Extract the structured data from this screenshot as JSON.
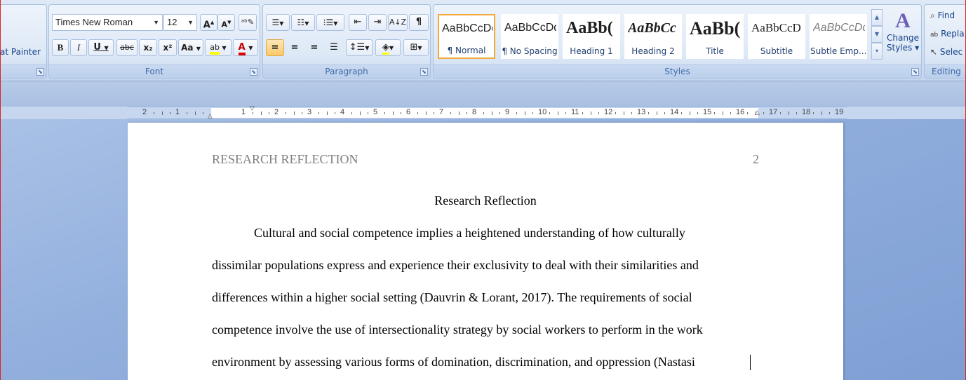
{
  "clipboard": {
    "format_painter_label": "at Painter"
  },
  "font": {
    "group_label": "Font",
    "font_name": "Times New Roman",
    "font_size": "12",
    "grow": "A",
    "shrink": "A",
    "bold": "B",
    "italic": "I",
    "underline": "U",
    "strike": "abc",
    "subscript": "x₂",
    "superscript": "x²",
    "change_case": "Aa",
    "highlight": "ab",
    "font_color": "A"
  },
  "paragraph": {
    "group_label": "Paragraph",
    "pilcrow": "¶"
  },
  "styles": {
    "group_label": "Styles",
    "items": [
      {
        "sample": "AaBbCcDd",
        "name": "¶ Normal"
      },
      {
        "sample": "AaBbCcDd",
        "name": "¶ No Spacing"
      },
      {
        "sample": "AaBb(",
        "name": "Heading 1"
      },
      {
        "sample": "AaBbCc",
        "name": "Heading 2"
      },
      {
        "sample": "AaBb(",
        "name": "Title"
      },
      {
        "sample": "AaBbCcD",
        "name": "Subtitle"
      },
      {
        "sample": "AaBbCcDd",
        "name": "Subtle Emp..."
      }
    ],
    "change_styles_line1": "Change",
    "change_styles_line2": "Styles ▾"
  },
  "editing": {
    "group_label": "Editing",
    "find": "Find",
    "replace": "Repla",
    "select": "Selec"
  },
  "ruler": {
    "numbers": [
      "2",
      "1",
      "1",
      "2",
      "3",
      "4",
      "5",
      "6",
      "7",
      "8",
      "9",
      "10",
      "11",
      "12",
      "13",
      "14",
      "15",
      "16",
      "17",
      "18",
      "19"
    ]
  },
  "document": {
    "header_left": "RESEARCH REFLECTION",
    "page_number": "2",
    "title": "Research Reflection",
    "lines": [
      "Cultural and social competence implies a heightened understanding of how culturally",
      "dissimilar populations express and experience their exclusivity to deal with their similarities and",
      "differences within a higher social setting (Dauvrin & Lorant, 2017). The requirements of social",
      "competence involve the use of intersectionality strategy by social workers to perform in the work",
      "environment by assessing various forms of domination, discrimination, and oppression (Nastasi"
    ]
  },
  "colors": {
    "accent": "#f2a93b",
    "ribbon": "#dfe9f5",
    "group_label": "#3e6aaa"
  }
}
